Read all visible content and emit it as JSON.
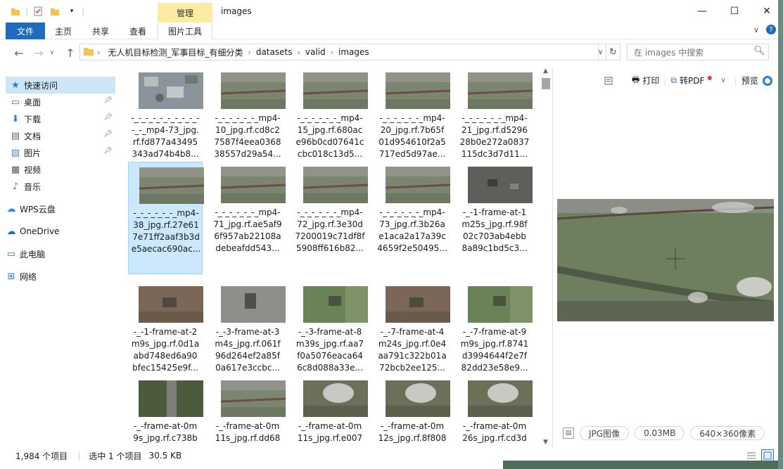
{
  "window": {
    "title": "images",
    "manage_tab": "管理"
  },
  "ribbon": {
    "tabs": [
      "文件",
      "主页",
      "共享",
      "查看",
      "图片工具"
    ]
  },
  "address": {
    "segments": [
      "无人机目标检测_军事目标_有细分类",
      "datasets",
      "valid",
      "images"
    ]
  },
  "search": {
    "placeholder": "在 images 中搜索"
  },
  "sidebar": {
    "items": [
      {
        "label": "快速访问",
        "icon": "star-icon",
        "pinned": false
      },
      {
        "label": "桌面",
        "icon": "desktop-icon",
        "pinned": true
      },
      {
        "label": "下载",
        "icon": "download-icon",
        "pinned": true
      },
      {
        "label": "文档",
        "icon": "document-icon",
        "pinned": true
      },
      {
        "label": "图片",
        "icon": "pictures-icon",
        "pinned": true
      },
      {
        "label": "视频",
        "icon": "video-icon",
        "pinned": false
      },
      {
        "label": "音乐",
        "icon": "music-icon",
        "pinned": false
      },
      {
        "label": "WPS云盘",
        "icon": "cloud-icon",
        "pinned": false
      },
      {
        "label": "OneDrive",
        "icon": "onedrive-icon",
        "pinned": false
      },
      {
        "label": "此电脑",
        "icon": "computer-icon",
        "pinned": false
      },
      {
        "label": "网络",
        "icon": "network-icon",
        "pinned": false
      }
    ]
  },
  "files": [
    {
      "lines": [
        "-_-_-_-_-_-_-_-_-_-",
        "-_-_mp4-73_jpg.",
        "rf.fd877a43495",
        "343ad74b4b8..."
      ],
      "thumb": "aerial"
    },
    {
      "lines": [
        "-_-_-_-_-_-_mp4-",
        "10_jpg.rf.cd8c2",
        "7587f4eea0368",
        "38557d29a54..."
      ],
      "thumb": "field"
    },
    {
      "lines": [
        "-_-_-_-_-_-_mp4-",
        "15_jpg.rf.680ac",
        "e96b0cd07641c",
        "cbc018c13d5..."
      ],
      "thumb": "field"
    },
    {
      "lines": [
        "-_-_-_-_-_-_mp4-",
        "20_jpg.rf.7b65f",
        "01d954610f2a5",
        "717ed5d97ae..."
      ],
      "thumb": "field"
    },
    {
      "lines": [
        "-_-_-_-_-_-_mp4-",
        "21_jpg.rf.d5296",
        "28b0e272a0837",
        "115dc3d7d11..."
      ],
      "thumb": "field"
    },
    {
      "lines": [
        "-_-_-_-_-_-_mp4-",
        "38_jpg.rf.27e61",
        "7e71ff2aaf3b3d",
        "e5aecac690ac..."
      ],
      "thumb": "field",
      "selected": true
    },
    {
      "lines": [
        "-_-_-_-_-_-_mp4-",
        "71_jpg.rf.ae5af9",
        "6f957ab22108a",
        "debeafdd543..."
      ],
      "thumb": "field"
    },
    {
      "lines": [
        "-_-_-_-_-_-_mp4-",
        "72_jpg.rf.3e30d",
        "7200019c71df8f",
        "5908ff616b82..."
      ],
      "thumb": "field"
    },
    {
      "lines": [
        "-_-_-_-_-_-_mp4-",
        "73_jpg.rf.3b26a",
        "e1aca2a17a39c",
        "4659f2e50495..."
      ],
      "thumb": "field"
    },
    {
      "lines": [
        "-_-1-frame-at-1",
        "m25s_jpg.rf.98f",
        "02c703ab4ebb",
        "8a89c1bd5c3..."
      ],
      "thumb": "dark"
    },
    {
      "lines": [
        "-_-1-frame-at-2",
        "m9s_jpg.rf.0d1a",
        "abd748ed6a90",
        "bfec15425e9f..."
      ],
      "thumb": "brown"
    },
    {
      "lines": [
        "-_-3-frame-at-3",
        "m4s_jpg.rf.061f",
        "96d264ef2a85f",
        "0a617e3ccbc..."
      ],
      "thumb": "gray"
    },
    {
      "lines": [
        "-_-3-frame-at-8",
        "m39s_jpg.rf.aa7",
        "f0a5076eaca64",
        "6c8d088a33e..."
      ],
      "thumb": "green"
    },
    {
      "lines": [
        "-_-7-frame-at-4",
        "m24s_jpg.rf.0e4",
        "aa791c322b01a",
        "72bcb2ee125..."
      ],
      "thumb": "brown"
    },
    {
      "lines": [
        "-_-7-frame-at-9",
        "m9s_jpg.rf.8741",
        "d3994644f2e7f",
        "82dd23e58e9..."
      ],
      "thumb": "green"
    },
    {
      "lines": [
        "-_-frame-at-0m",
        "9s_jpg.rf.c738b"
      ],
      "thumb": "road"
    },
    {
      "lines": [
        "-_-frame-at-0m",
        "11s_jpg.rf.dd68"
      ],
      "thumb": "field"
    },
    {
      "lines": [
        "-_-frame-at-0m",
        "11s_jpg.rf.e007"
      ],
      "thumb": "smoke"
    },
    {
      "lines": [
        "-_-frame-at-0m",
        "12s_jpg.rf.8f808"
      ],
      "thumb": "smoke"
    },
    {
      "lines": [
        "-_-frame-at-0m",
        "26s_jpg.rf.cd3d"
      ],
      "thumb": "smoke"
    }
  ],
  "preview": {
    "print": "打印",
    "to_pdf": "转PDF",
    "preview_label": "预览",
    "type": "JPG图像",
    "size": "0.03MB",
    "dims": "640×360像素"
  },
  "status": {
    "count": "1,984 个项目",
    "selected": "选中 1 个项目",
    "selsize": "30.5 KB"
  },
  "colors": {
    "accent": "#1f6bbd",
    "selected_bg": "#cce8ff",
    "manage_bg": "#fbeca3"
  }
}
